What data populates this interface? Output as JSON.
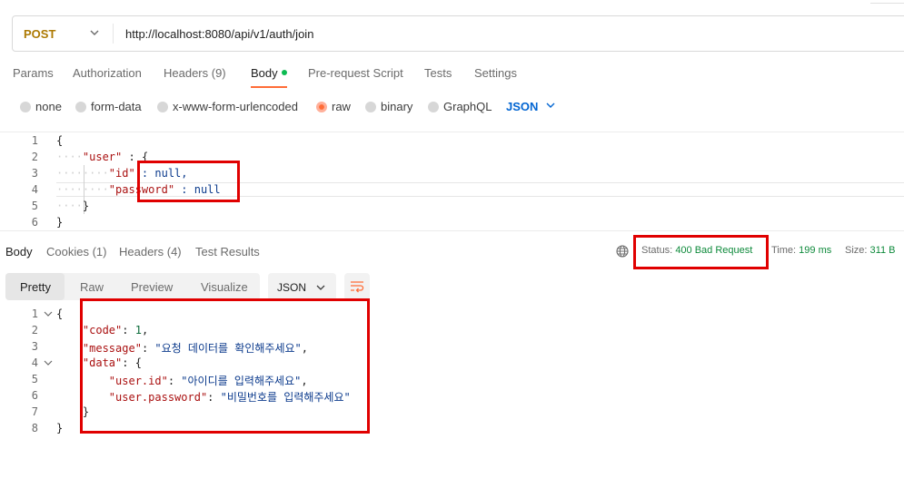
{
  "request": {
    "method": "POST",
    "url": "http://localhost:8080/api/v1/auth/join",
    "tabs": [
      "Params",
      "Authorization",
      "Headers (9)",
      "Body",
      "Pre-request Script",
      "Tests",
      "Settings"
    ],
    "body_types": [
      "none",
      "form-data",
      "x-www-form-urlencoded",
      "raw",
      "binary",
      "GraphQL"
    ],
    "selected_body_type": "raw",
    "format": "JSON",
    "line_numbers": [
      "1",
      "2",
      "3",
      "4",
      "5",
      "6"
    ],
    "code": {
      "l1": "{",
      "l2_key": "\"user\"",
      "l2_rest": " : {",
      "l3_key": "\"id\"",
      "l3_rest": " : null,",
      "l4_key": "\"password\"",
      "l4_rest": " : null",
      "l5": "}",
      "l6": "}"
    }
  },
  "response": {
    "tabs": [
      "Body",
      "Cookies (1)",
      "Headers (4)",
      "Test Results"
    ],
    "status_label": "Status:",
    "status_value": "400 Bad Request",
    "time_label": "Time:",
    "time_value": "199 ms",
    "size_label": "Size:",
    "size_value": "311 B",
    "views": [
      "Pretty",
      "Raw",
      "Preview",
      "Visualize"
    ],
    "format": "JSON",
    "line_numbers": [
      "1",
      "2",
      "3",
      "4",
      "5",
      "6",
      "7",
      "8"
    ],
    "body": {
      "open": "{",
      "code_key": "\"code\"",
      "code_val": "1",
      "message_key": "\"message\"",
      "message_val": "\"요청 데이터를 확인해주세요\"",
      "data_key": "\"data\"",
      "data_open": "{",
      "uid_key": "\"user.id\"",
      "uid_val": "\"아이디를 입력해주세요\"",
      "upw_key": "\"user.password\"",
      "upw_val": "\"비밀번호를 입력해주세요\"",
      "data_close": "}",
      "close": "}"
    }
  },
  "colors": {
    "accent": "#ff6c37",
    "method": "#ad7a03",
    "status_ok": "#0e8a3b",
    "highlight": "#e00000"
  }
}
